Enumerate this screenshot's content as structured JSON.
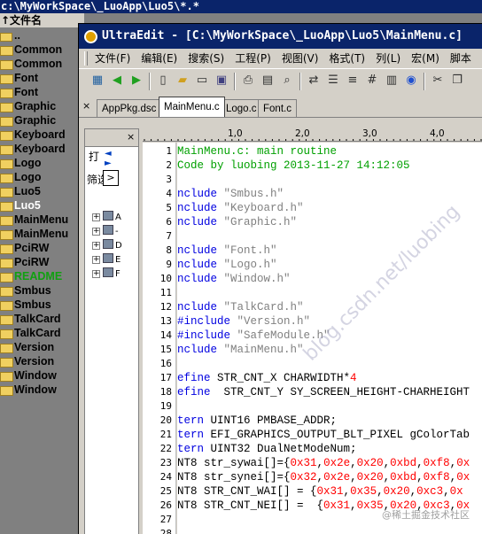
{
  "bg": {
    "title": "c:\\MyWorkSpace\\_LuoApp\\Luo5\\*.*",
    "header": "↑文件名",
    "items": [
      {
        "label": "..",
        "kind": "up"
      },
      {
        "label": "Common",
        "kind": "folder"
      },
      {
        "label": "Common",
        "kind": "folder"
      },
      {
        "label": "Font",
        "kind": "folder"
      },
      {
        "label": "Font",
        "kind": "folder"
      },
      {
        "label": "Graphic",
        "kind": "folder"
      },
      {
        "label": "Graphic",
        "kind": "folder"
      },
      {
        "label": "Keyboard",
        "kind": "folder"
      },
      {
        "label": "Keyboard",
        "kind": "folder"
      },
      {
        "label": "Logo",
        "kind": "folder"
      },
      {
        "label": "Logo",
        "kind": "folder"
      },
      {
        "label": "Luo5",
        "kind": "folder"
      },
      {
        "label": "Luo5",
        "kind": "folder",
        "highlight": true
      },
      {
        "label": "MainMenu",
        "kind": "folder"
      },
      {
        "label": "MainMenu",
        "kind": "folder"
      },
      {
        "label": "PciRW",
        "kind": "folder"
      },
      {
        "label": "PciRW",
        "kind": "folder"
      },
      {
        "label": "README",
        "kind": "folder",
        "green": true
      },
      {
        "label": "Smbus",
        "kind": "folder"
      },
      {
        "label": "Smbus",
        "kind": "folder"
      },
      {
        "label": "TalkCard",
        "kind": "folder"
      },
      {
        "label": "TalkCard",
        "kind": "folder"
      },
      {
        "label": "Version",
        "kind": "folder"
      },
      {
        "label": "Version",
        "kind": "folder"
      },
      {
        "label": "Window",
        "kind": "folder"
      },
      {
        "label": "Window",
        "kind": "folder"
      }
    ]
  },
  "ue": {
    "title": "UltraEdit - [C:\\MyWorkSpace\\_LuoApp\\Luo5\\MainMenu.c]",
    "menu": [
      "文件(F)",
      "编辑(E)",
      "搜索(S)",
      "工程(P)",
      "视图(V)",
      "格式(T)",
      "列(L)",
      "宏(M)",
      "脚本"
    ],
    "toolbar_icons": [
      "open-project-icon",
      "back-arrow-icon",
      "forward-arrow-icon",
      "new-file-icon",
      "open-folder-icon",
      "open-file-icon",
      "save-icon",
      "print-icon",
      "print-preview-icon",
      "find-icon",
      "find-replace-icon",
      "document-icon",
      "list-icon",
      "hex-icon",
      "notes-icon",
      "web-icon",
      "cut-icon",
      "copy-icon"
    ],
    "tabs": [
      "AppPkg.dsc",
      "MainMenu.c",
      "Logo.c",
      "Font.c"
    ],
    "active_tab": 1,
    "tab_close": "×",
    "panel": {
      "close": "×",
      "tab_label": "打",
      "arrows": "◄ ►",
      "filter_label": "筛选",
      "filter_button": ">",
      "tree": [
        {
          "plus": "+",
          "label": "A"
        },
        {
          "plus": "+",
          "label": "-"
        },
        {
          "plus": "+",
          "label": "D"
        },
        {
          "plus": "+",
          "label": "E"
        },
        {
          "plus": "+",
          "label": "F"
        }
      ]
    },
    "ruler": [
      "1,0",
      "2,0",
      "3,0",
      "4,0"
    ],
    "lines": [
      {
        "n": "1",
        "parts": [
          {
            "t": "MainMenu.c: main routine",
            "c": "c-comment"
          }
        ]
      },
      {
        "n": "2",
        "parts": [
          {
            "t": "Code by luobing 2013-11-27 14:12:05",
            "c": "c-comment"
          }
        ]
      },
      {
        "n": "3",
        "parts": []
      },
      {
        "n": "4",
        "parts": [
          {
            "t": "nclude ",
            "c": "c-pp"
          },
          {
            "t": "\"Smbus.h\"",
            "c": "c-str"
          }
        ]
      },
      {
        "n": "5",
        "parts": [
          {
            "t": "nclude ",
            "c": "c-pp"
          },
          {
            "t": "\"Keyboard.h\"",
            "c": "c-str"
          }
        ]
      },
      {
        "n": "6",
        "parts": [
          {
            "t": "nclude ",
            "c": "c-pp"
          },
          {
            "t": "\"Graphic.h\"",
            "c": "c-str"
          }
        ]
      },
      {
        "n": "7",
        "parts": []
      },
      {
        "n": "8",
        "parts": [
          {
            "t": "nclude ",
            "c": "c-pp"
          },
          {
            "t": "\"Font.h\"",
            "c": "c-str"
          }
        ]
      },
      {
        "n": "9",
        "parts": [
          {
            "t": "nclude ",
            "c": "c-pp"
          },
          {
            "t": "\"Logo.h\"",
            "c": "c-str"
          }
        ]
      },
      {
        "n": "10",
        "parts": [
          {
            "t": "nclude ",
            "c": "c-pp"
          },
          {
            "t": "\"Window.h\"",
            "c": "c-str"
          }
        ]
      },
      {
        "n": "11",
        "parts": []
      },
      {
        "n": "12",
        "parts": [
          {
            "t": "nclude ",
            "c": "c-pp"
          },
          {
            "t": "\"TalkCard.h\"",
            "c": "c-str"
          }
        ]
      },
      {
        "n": "13",
        "parts": [
          {
            "t": "#include ",
            "c": "c-pp"
          },
          {
            "t": "\"Version.h\"",
            "c": "c-str"
          }
        ]
      },
      {
        "n": "14",
        "parts": [
          {
            "t": "#include ",
            "c": "c-pp"
          },
          {
            "t": "\"SafeModule.h\"",
            "c": "c-str"
          }
        ]
      },
      {
        "n": "15",
        "parts": [
          {
            "t": "nclude ",
            "c": "c-pp"
          },
          {
            "t": "\"MainMenu.h\"",
            "c": "c-str"
          }
        ]
      },
      {
        "n": "16",
        "parts": []
      },
      {
        "n": "17",
        "parts": [
          {
            "t": "efine ",
            "c": "c-pp"
          },
          {
            "t": "STR_CNT_X CHARWIDTH*",
            "c": "c-plain"
          },
          {
            "t": "4",
            "c": "c-num"
          }
        ]
      },
      {
        "n": "18",
        "parts": [
          {
            "t": "efine  ",
            "c": "c-pp"
          },
          {
            "t": "STR_CNT_Y SY_SCREEN_HEIGHT-CHARHEIGHT",
            "c": "c-plain"
          }
        ]
      },
      {
        "n": "19",
        "parts": []
      },
      {
        "n": "20",
        "parts": [
          {
            "t": "tern ",
            "c": "c-kw"
          },
          {
            "t": "UINT16 PMBASE_ADDR;",
            "c": "c-plain"
          }
        ]
      },
      {
        "n": "21",
        "parts": [
          {
            "t": "tern ",
            "c": "c-kw"
          },
          {
            "t": "EFI_GRAPHICS_OUTPUT_BLT_PIXEL gColorTab",
            "c": "c-plain"
          }
        ]
      },
      {
        "n": "22",
        "parts": [
          {
            "t": "tern ",
            "c": "c-kw"
          },
          {
            "t": "UINT32 DualNetModeNum;",
            "c": "c-plain"
          }
        ]
      },
      {
        "n": "23",
        "parts": [
          {
            "t": "NT8 str_sywai[]={",
            "c": "c-plain"
          },
          {
            "t": "0x31",
            "c": "c-num"
          },
          {
            "t": ",",
            "c": "c-plain"
          },
          {
            "t": "0x2e",
            "c": "c-num"
          },
          {
            "t": ",",
            "c": "c-plain"
          },
          {
            "t": "0x20",
            "c": "c-num"
          },
          {
            "t": ",",
            "c": "c-plain"
          },
          {
            "t": "0xbd",
            "c": "c-num"
          },
          {
            "t": ",",
            "c": "c-plain"
          },
          {
            "t": "0xf8",
            "c": "c-num"
          },
          {
            "t": ",",
            "c": "c-plain"
          },
          {
            "t": "0x",
            "c": "c-num"
          }
        ]
      },
      {
        "n": "24",
        "parts": [
          {
            "t": "NT8 str_synei[]={",
            "c": "c-plain"
          },
          {
            "t": "0x32",
            "c": "c-num"
          },
          {
            "t": ",",
            "c": "c-plain"
          },
          {
            "t": "0x2e",
            "c": "c-num"
          },
          {
            "t": ",",
            "c": "c-plain"
          },
          {
            "t": "0x20",
            "c": "c-num"
          },
          {
            "t": ",",
            "c": "c-plain"
          },
          {
            "t": "0xbd",
            "c": "c-num"
          },
          {
            "t": ",",
            "c": "c-plain"
          },
          {
            "t": "0xf8",
            "c": "c-num"
          },
          {
            "t": ",",
            "c": "c-plain"
          },
          {
            "t": "0x",
            "c": "c-num"
          }
        ]
      },
      {
        "n": "25",
        "parts": [
          {
            "t": "NT8 STR_CNT_WAI[] = {",
            "c": "c-plain"
          },
          {
            "t": "0x31",
            "c": "c-num"
          },
          {
            "t": ",",
            "c": "c-plain"
          },
          {
            "t": "0x35",
            "c": "c-num"
          },
          {
            "t": ",",
            "c": "c-plain"
          },
          {
            "t": "0x20",
            "c": "c-num"
          },
          {
            "t": ",",
            "c": "c-plain"
          },
          {
            "t": "0xc3",
            "c": "c-num"
          },
          {
            "t": ",",
            "c": "c-plain"
          },
          {
            "t": "0x",
            "c": "c-num"
          }
        ]
      },
      {
        "n": "26",
        "parts": [
          {
            "t": "NT8 STR_CNT_NEI[] =  {",
            "c": "c-plain"
          },
          {
            "t": "0x31",
            "c": "c-num"
          },
          {
            "t": ",",
            "c": "c-plain"
          },
          {
            "t": "0x35",
            "c": "c-num"
          },
          {
            "t": ",",
            "c": "c-plain"
          },
          {
            "t": "0x20",
            "c": "c-num"
          },
          {
            "t": ",",
            "c": "c-plain"
          },
          {
            "t": "0xc3",
            "c": "c-num"
          },
          {
            "t": ",",
            "c": "c-plain"
          },
          {
            "t": "0x",
            "c": "c-num"
          }
        ]
      },
      {
        "n": "27",
        "parts": []
      },
      {
        "n": "28",
        "parts": []
      }
    ],
    "watermark": "blog.csdn.net/luobing",
    "corner_mark": "@稀土掘金技术社区"
  },
  "colors": {
    "title_bar": "#0a246a",
    "chrome": "#d4d0c8",
    "comment": "#00a000",
    "keyword": "#0000e0",
    "string": "#808080",
    "number": "#ff0000"
  }
}
